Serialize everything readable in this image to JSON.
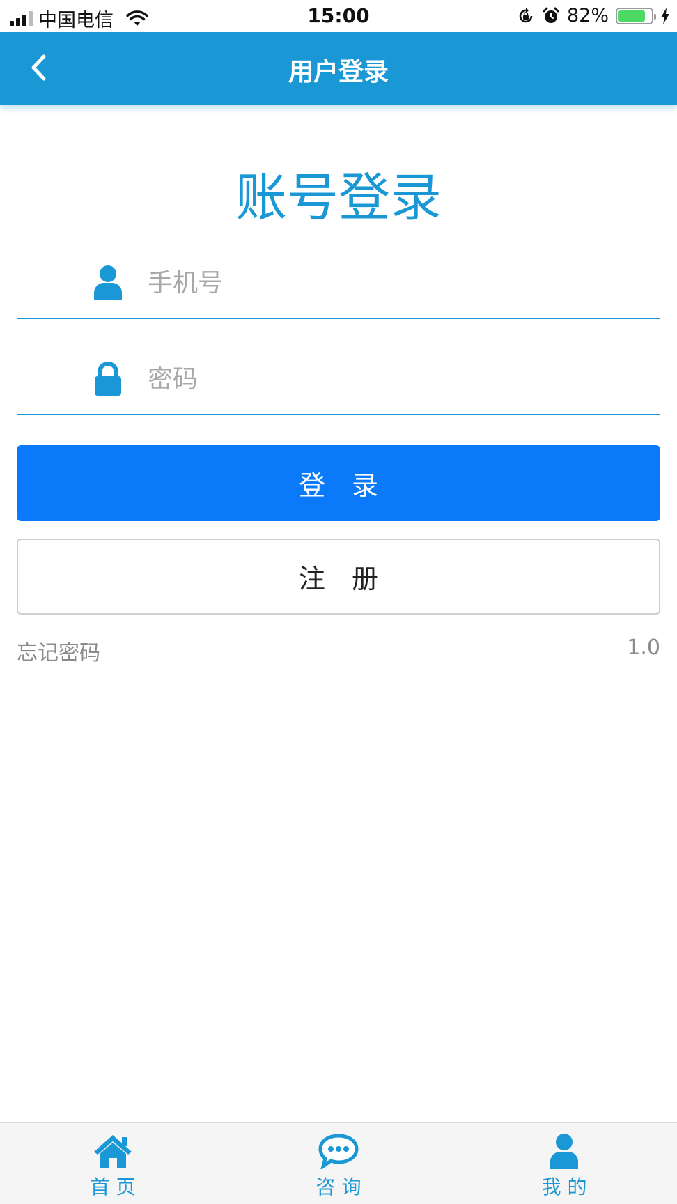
{
  "status_bar": {
    "carrier": "中国电信",
    "time": "15:00",
    "battery_percent": "82%",
    "battery_level": 0.82
  },
  "nav": {
    "title": "用户登录",
    "back_icon": "chevron-left-icon"
  },
  "page": {
    "title": "账号登录"
  },
  "form": {
    "phone": {
      "placeholder": "手机号",
      "value": "",
      "icon": "user-icon"
    },
    "password": {
      "placeholder": "密码",
      "value": "",
      "icon": "lock-icon"
    },
    "login_label": "登　录",
    "register_label": "注　册",
    "forgot_label": "忘记密码",
    "version": "1.0"
  },
  "tabs": [
    {
      "label": "首 页",
      "icon": "home-icon"
    },
    {
      "label": "咨 询",
      "icon": "chat-bubble-icon"
    },
    {
      "label": "我 的",
      "icon": "user-icon"
    }
  ],
  "colors": {
    "primary": "#1a98d5",
    "button": "#0a7afa",
    "muted_text": "#8a8a8a",
    "battery": "#4cd964"
  }
}
